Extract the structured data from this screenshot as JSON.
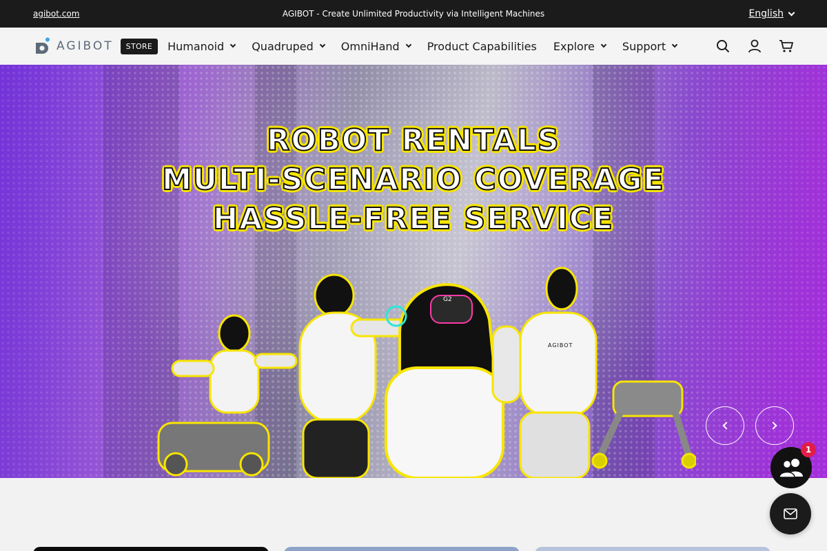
{
  "announcement": {
    "left_link": "agibot.com",
    "center_text": "AGIBOT - Create Unlimited Productivity via Intelligent Machines",
    "language": "English"
  },
  "header": {
    "logo_text": "AGIBOT",
    "store_badge": "STORE",
    "nav": [
      {
        "label": "Humanoid",
        "has_dropdown": true
      },
      {
        "label": "Quadruped",
        "has_dropdown": true
      },
      {
        "label": "OmniHand",
        "has_dropdown": true
      },
      {
        "label": "Product Capabilities",
        "has_dropdown": false
      },
      {
        "label": "Explore",
        "has_dropdown": true
      },
      {
        "label": "Support",
        "has_dropdown": true
      }
    ],
    "icons": [
      "search-icon",
      "account-icon",
      "cart-icon"
    ]
  },
  "hero": {
    "lines": [
      "ROBOT RENTALS",
      "MULTI-SCENARIO COVERAGE",
      "HASSLE-FREE SERVICE"
    ],
    "robot_label_1": "G2",
    "robot_label_2": "AGIBOT",
    "prev_icon": "chevron-left-icon",
    "next_icon": "chevron-right-icon"
  },
  "floating": {
    "chat_badge_count": "1",
    "chat_icon": "users-chat-icon",
    "mail_icon": "mail-icon"
  },
  "colors": {
    "dark": "#1b1b1b",
    "accent_yellow": "#f7e500",
    "badge_red": "#e11d48",
    "hero_purple": "#7a3fe0"
  }
}
